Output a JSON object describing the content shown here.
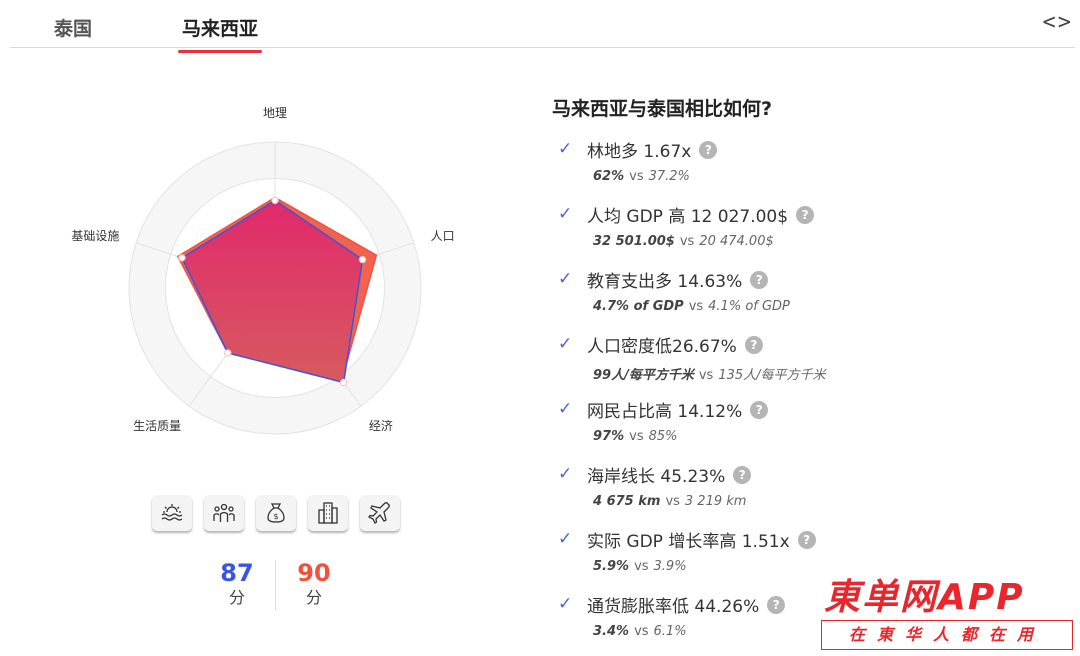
{
  "tabs": [
    {
      "label": "泰国",
      "active": false
    },
    {
      "label": "马来西亚",
      "active": true
    }
  ],
  "nav": {
    "arrows": "<>"
  },
  "radar": {
    "axes": [
      "地理",
      "人口",
      "经济",
      "生活质量",
      "基础设施"
    ],
    "ring_count": 4,
    "series": [
      {
        "color": "#3a56e0",
        "values": [
          0.6,
          0.63,
          0.8,
          0.55,
          0.67
        ]
      },
      {
        "color": "#f0523c",
        "values": [
          0.62,
          0.73,
          0.78,
          0.55,
          0.7
        ]
      }
    ]
  },
  "icons": [
    "landscape-icon",
    "people-icon",
    "money-bag-icon",
    "buildings-icon",
    "airplane-icon"
  ],
  "scores": [
    {
      "value": "87",
      "unit": "分",
      "color": "#3a56e0"
    },
    {
      "value": "90",
      "unit": "分",
      "color": "#f0523c"
    }
  ],
  "comparison": {
    "title": "马来西亚与泰国相比如何?",
    "check": "✓",
    "vs": "vs",
    "items": [
      {
        "text": "林地多 1.67x",
        "v1": "62%",
        "v2": "37.2%"
      },
      {
        "text": "人均 GDP 高 12 027.00$",
        "v1": "32 501.00$",
        "v2": "20 474.00$"
      },
      {
        "text": "教育支出多 14.63%",
        "v1": "4.7% of GDP",
        "v2": "4.1% of GDP"
      },
      {
        "text": "人口密度低26.67%",
        "v1": "99人/每平方千米",
        "v2": "135人/每平方千米"
      },
      {
        "text": "网民占比高 14.12%",
        "v1": "97%",
        "v2": "85%"
      },
      {
        "text": "海岸线长 45.23%",
        "v1": "4 675 km",
        "v2": "3 219 km"
      },
      {
        "text": "实际 GDP 增长率高 1.51x",
        "v1": "5.9%",
        "v2": "3.9%"
      },
      {
        "text": "通货膨胀率低 44.26%",
        "v1": "3.4%",
        "v2": "6.1%"
      }
    ]
  },
  "watermark": {
    "brand": "東单网APP",
    "slogan": "在東华人都在用"
  }
}
